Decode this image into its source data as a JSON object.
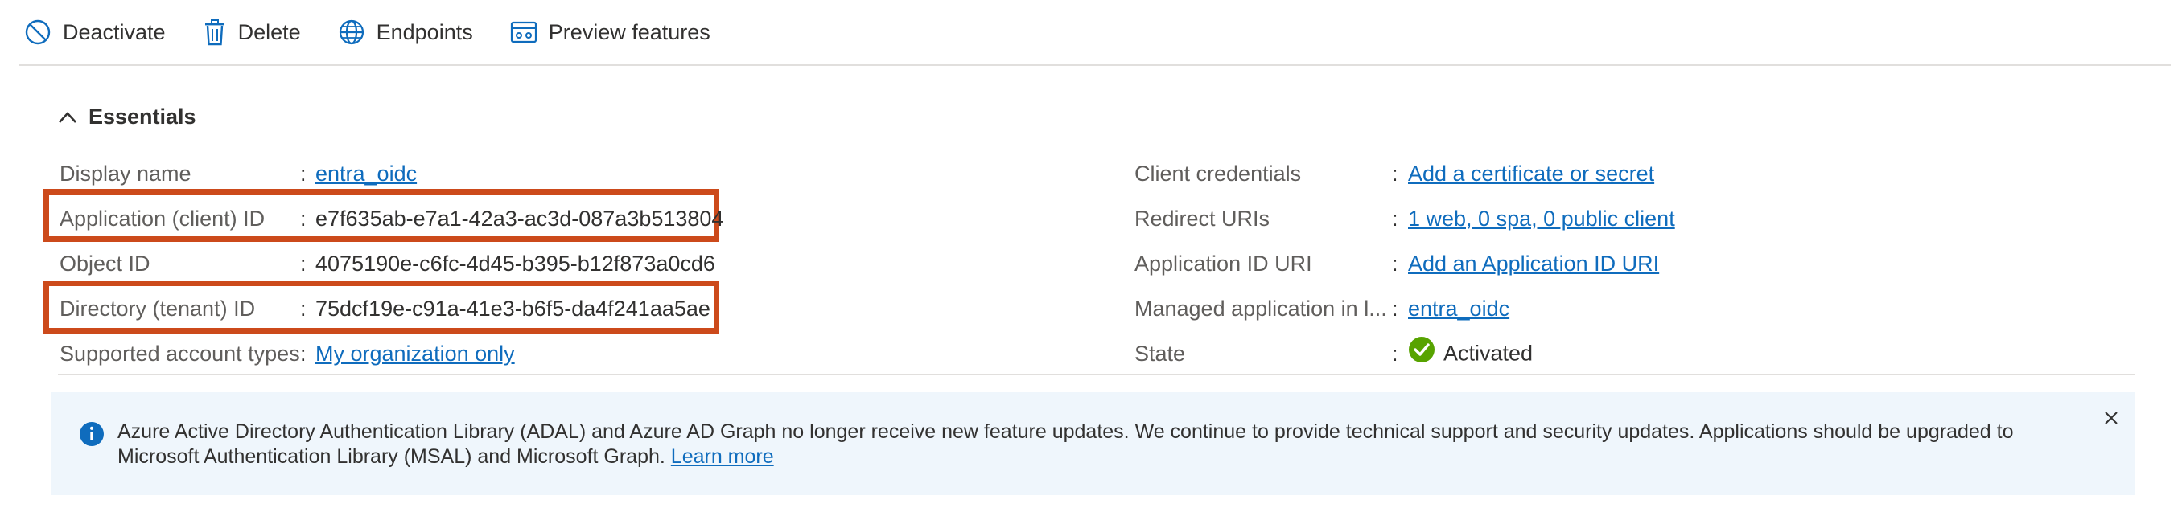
{
  "toolbar": {
    "deactivate": "Deactivate",
    "delete": "Delete",
    "endpoints": "Endpoints",
    "preview_features": "Preview features"
  },
  "essentials": {
    "title": "Essentials",
    "left": [
      {
        "label": "Display name",
        "value": "entra_oidc",
        "link": true
      },
      {
        "label": "Application (client) ID",
        "value": "e7f635ab-e7a1-42a3-ac3d-087a3b513804",
        "link": false
      },
      {
        "label": "Object ID",
        "value": "4075190e-c6fc-4d45-b395-b12f873a0cd6",
        "link": false
      },
      {
        "label": "Directory (tenant) ID",
        "value": "75dcf19e-c91a-41e3-b6f5-da4f241aa5ae",
        "link": false
      },
      {
        "label": "Supported account types",
        "value": "My organization only",
        "link": true
      }
    ],
    "right": [
      {
        "label": "Client credentials",
        "value": "Add a certificate or secret",
        "link": true
      },
      {
        "label": "Redirect URIs",
        "value": "1 web, 0 spa, 0 public client",
        "link": true
      },
      {
        "label": "Application ID URI",
        "value": "Add an Application ID URI",
        "link": true
      },
      {
        "label": "Managed application in l...",
        "value": "entra_oidc",
        "link": true
      },
      {
        "label": "State",
        "value": "Activated",
        "link": false
      }
    ]
  },
  "banner": {
    "text": "Azure Active Directory Authentication Library (ADAL) and Azure AD Graph no longer receive new feature updates. We continue to provide technical support and security updates. Applications should be upgraded to Microsoft Authentication Library (MSAL) and Microsoft Graph.",
    "link": "Learn more"
  },
  "colors": {
    "link": "#0f6cbd",
    "highlight": "#cc4a1b",
    "success": "#57a300",
    "banner_bg": "#eff6fc",
    "info": "#0f6cbd"
  }
}
